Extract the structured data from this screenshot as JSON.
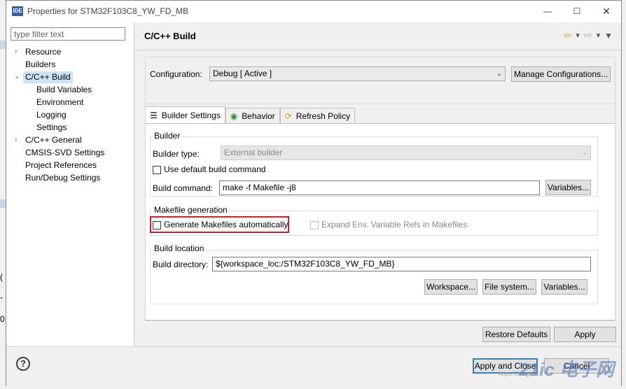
{
  "window": {
    "title": "Properties for STM32F103C8_YW_FD_MB",
    "icon_label": "IDE",
    "minimize": "—",
    "maximize": "☐",
    "close": "✕"
  },
  "sidebar": {
    "filter_placeholder": "type filter text",
    "items": [
      {
        "label": "Resource",
        "expanded": false,
        "has_children": true
      },
      {
        "label": "Builders"
      },
      {
        "label": "C/C++ Build",
        "expanded": true,
        "selected": true
      },
      {
        "label": "Build Variables"
      },
      {
        "label": "Environment"
      },
      {
        "label": "Logging"
      },
      {
        "label": "Settings"
      },
      {
        "label": "C/C++ General",
        "has_children": true
      },
      {
        "label": "CMSIS-SVD Settings"
      },
      {
        "label": "Project References"
      },
      {
        "label": "Run/Debug Settings"
      }
    ]
  },
  "page": {
    "title": "C/C++ Build",
    "config_label": "Configuration:",
    "config_value": "Debug  [ Active ]",
    "manage_button": "Manage Configurations...",
    "tabs": [
      {
        "label": "Builder Settings",
        "icon": "list-icon"
      },
      {
        "label": "Behavior",
        "icon": "radio-icon"
      },
      {
        "label": "Refresh Policy",
        "icon": "refresh-icon"
      }
    ],
    "builder": {
      "group": "Builder",
      "type_label": "Builder type:",
      "type_value": "External builder",
      "use_default_label": "Use default build command",
      "use_default_checked": false,
      "command_label": "Build command:",
      "command_value": "make -f Makefile -j8",
      "variables_button": "Variables..."
    },
    "makefile": {
      "group": "Makefile generation",
      "generate_label": "Generate Makefiles automatically",
      "generate_checked": false,
      "expand_label": "Expand Env. Variable Refs in Makefiles",
      "expand_checked": false
    },
    "location": {
      "group": "Build location",
      "dir_label": "Build directory:",
      "dir_value": "${workspace_loc:/STM32F103C8_YW_FD_MB}",
      "workspace_button": "Workspace...",
      "filesystem_button": "File system...",
      "variables_button": "Variables..."
    },
    "restore_button": "Restore Defaults",
    "apply_button": "Apply"
  },
  "footer": {
    "help": "?",
    "apply_close_button": "Apply and Close",
    "cancel_button": "Cancel",
    "watermark": "21ic 电子网",
    "watermark_url": "https://blog.cs"
  },
  "background_fragments": [
    "(",
    "-",
    "0"
  ],
  "colors": {
    "highlight_box": "#c0202a",
    "selection": "#cce4f7"
  }
}
